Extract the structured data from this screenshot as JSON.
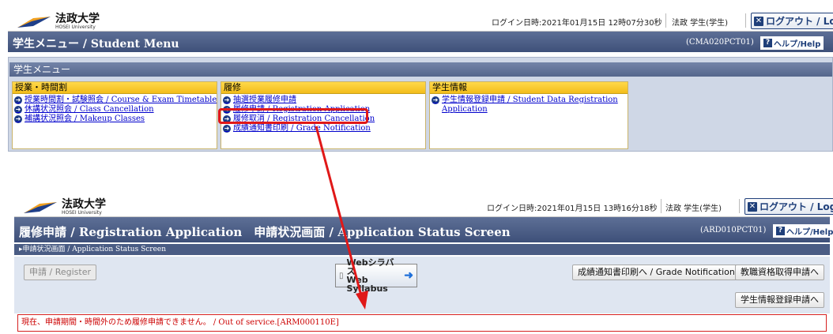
{
  "brand": {
    "name_jp": "法政大学",
    "name_en": "HOSEI University"
  },
  "top_screen": {
    "login_info": "ログイン日時:2021年01月15日 12時07分30秒",
    "user": "法政 学生(学生)",
    "logout": "ログアウト / Log out",
    "title": "学生メニュー / Student Menu",
    "screen_code": "(CMA020PCT01)",
    "help": "ヘルプ/Help",
    "menu_title": "学生メニュー",
    "columns": [
      {
        "heading": "授業・時間割",
        "links": [
          "授業時間割・試験照会 / Course & Exam Timetable",
          "休講状況照会 / Class Cancellation",
          "補講状況照会 / Makeup Classes"
        ]
      },
      {
        "heading": "履修",
        "links": [
          "抽選授業履修申請",
          "履修申請 / Registration Application",
          "履修取消 / Registration Cancellation",
          "成績通知書印刷 / Grade Notification"
        ]
      },
      {
        "heading": "学生情報",
        "links": [
          "学生情報登録申請 / Student Data Registration",
          "Application"
        ]
      }
    ]
  },
  "bottom_screen": {
    "login_info": "ログイン日時:2021年01月15日 13時16分18秒",
    "user": "法政 学生(学生)",
    "logout": "ログアウト / Log out",
    "title": "履修申請 / Registration Application　申請状況画面 / Application Status Screen",
    "screen_code": "(ARD010PCT01)",
    "help": "ヘルプ/Help",
    "breadcrumb": "▸申請状況画面 / Application Status Screen",
    "register_button": "申請 / Register",
    "syllabus_line1": "Webシラバス",
    "syllabus_line2": "Web Syllabus",
    "grade_button": "成績通知書印刷へ / Grade Notification",
    "teacher_button": "教職資格取得申請へ",
    "student_info_button": "学生情報登録申請へ",
    "error_message": "現在、申請期間・時間外のため履修申請できません。 / Out of service.[ARM000110E]"
  },
  "colors": {
    "highlight": "#e01818",
    "band": "#4a5c84",
    "link": "#0000cc"
  }
}
